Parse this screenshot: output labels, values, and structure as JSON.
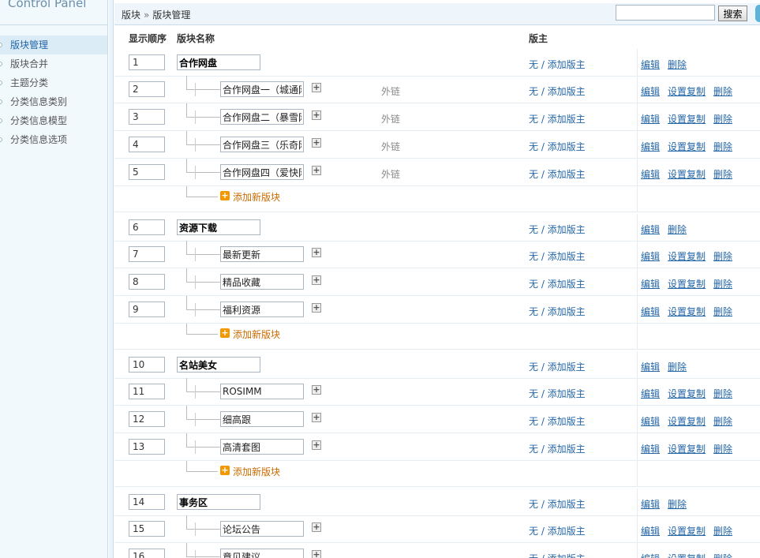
{
  "sidebar": {
    "brand": "Control Panel",
    "items": [
      {
        "label": "版块管理",
        "active": true
      },
      {
        "label": "版块合并",
        "active": false
      },
      {
        "label": "主题分类",
        "active": false
      },
      {
        "label": "分类信息类别",
        "active": false
      },
      {
        "label": "分类信息模型",
        "active": false
      },
      {
        "label": "分类信息选项",
        "active": false
      }
    ]
  },
  "breadcrumb": {
    "root": "版块",
    "separator": "»",
    "current": "版块管理"
  },
  "search": {
    "value": "",
    "button_label": "搜索"
  },
  "columns": {
    "order": "显示顺序",
    "name": "版块名称",
    "moderators": "版主"
  },
  "common": {
    "moderators_text": "无 / 添加版主",
    "edit": "编辑",
    "copy": "设置复制",
    "delete": "删除",
    "external_link": "外链",
    "add_forum": "添加新版块",
    "plus_glyph": "+"
  },
  "groups": [
    {
      "order": "1",
      "name": "合作网盘",
      "forums": [
        {
          "order": "2",
          "name": "合作网盘一（城通网盘）",
          "external": true
        },
        {
          "order": "3",
          "name": "合作网盘二（暴雪网盘）",
          "external": true
        },
        {
          "order": "4",
          "name": "合作网盘三（乐奇网盘）",
          "external": true
        },
        {
          "order": "5",
          "name": "合作网盘四（爱快网盘）",
          "external": true
        }
      ]
    },
    {
      "order": "6",
      "name": "资源下载",
      "forums": [
        {
          "order": "7",
          "name": "最新更新",
          "external": false
        },
        {
          "order": "8",
          "name": "精品收藏",
          "external": false
        },
        {
          "order": "9",
          "name": "福利资源",
          "external": false
        }
      ]
    },
    {
      "order": "10",
      "name": "名站美女",
      "forums": [
        {
          "order": "11",
          "name": "ROSIMM",
          "external": false
        },
        {
          "order": "12",
          "name": "细高跟",
          "external": false
        },
        {
          "order": "13",
          "name": "高清套图",
          "external": false
        }
      ]
    },
    {
      "order": "14",
      "name": "事务区",
      "forums": [
        {
          "order": "15",
          "name": "论坛公告",
          "external": false
        },
        {
          "order": "16",
          "name": "意见建议",
          "external": false
        }
      ]
    }
  ]
}
